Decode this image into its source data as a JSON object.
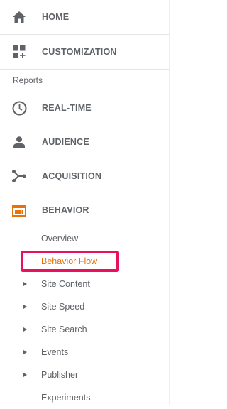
{
  "top_nav": [
    {
      "label": "HOME",
      "icon": "home-icon"
    },
    {
      "label": "CUSTOMIZATION",
      "icon": "customization-icon"
    }
  ],
  "reports_heading": "Reports",
  "reports": [
    {
      "label": "REAL-TIME",
      "icon": "clock-icon"
    },
    {
      "label": "AUDIENCE",
      "icon": "person-icon"
    },
    {
      "label": "ACQUISITION",
      "icon": "acquisition-icon"
    },
    {
      "label": "BEHAVIOR",
      "icon": "behavior-icon",
      "expanded": true
    }
  ],
  "behavior_sub_items": [
    {
      "label": "Overview",
      "has_arrow": false
    },
    {
      "label": "Behavior Flow",
      "has_arrow": false,
      "active": true
    },
    {
      "label": "Site Content",
      "has_arrow": true
    },
    {
      "label": "Site Speed",
      "has_arrow": true
    },
    {
      "label": "Site Search",
      "has_arrow": true
    },
    {
      "label": "Events",
      "has_arrow": true
    },
    {
      "label": "Publisher",
      "has_arrow": true
    },
    {
      "label": "Experiments",
      "has_arrow": false
    }
  ],
  "colors": {
    "text": "#5f6368",
    "active": "#e8710a",
    "highlight": "#e9105e",
    "behavior_icon": "#e8710a"
  }
}
